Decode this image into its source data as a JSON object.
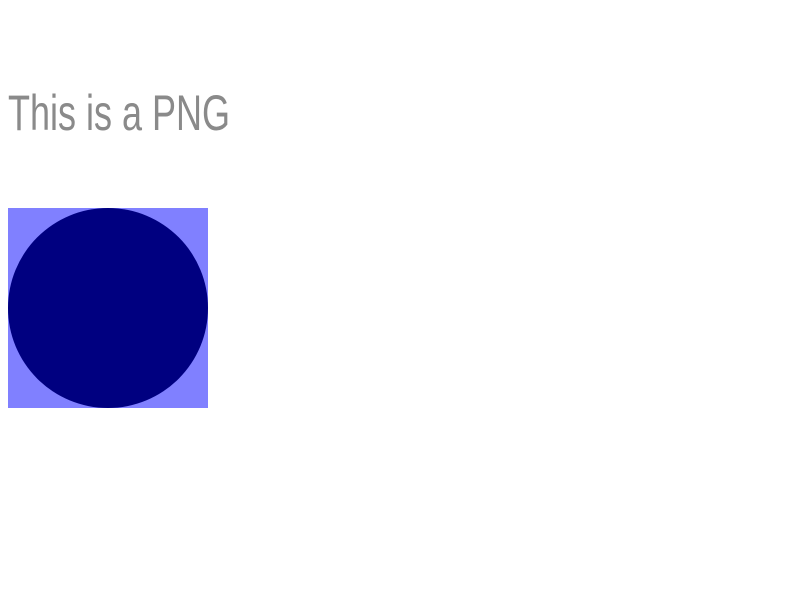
{
  "heading": {
    "text": "This is a PNG"
  },
  "image": {
    "background_color": "#8080ff",
    "circle_color": "#000080"
  }
}
